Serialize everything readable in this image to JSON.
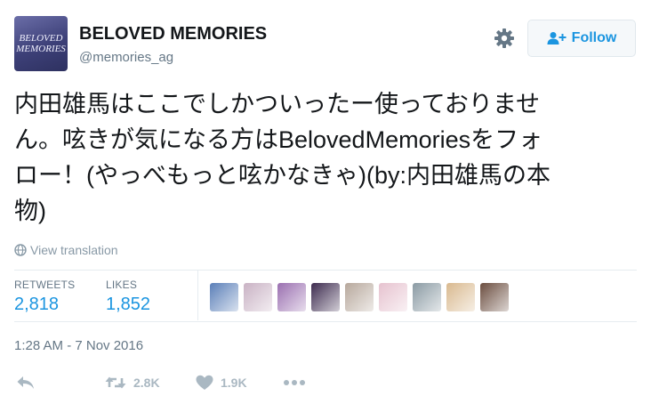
{
  "user": {
    "display_name": "BELOVED MEMORIES",
    "handle": "@memories_ag",
    "avatar_text": "BELOVED MEMORIES"
  },
  "follow_label": "Follow",
  "tweet": {
    "line1": "内田雄馬はここでしかついったー使っておりませ",
    "line2": "ん。呟きが気になる方はBelovedMemoriesをフォ",
    "line3": "ロー！(やっべもっと呟かなきゃ)(by:内田雄馬の本",
    "line4": "物)"
  },
  "view_translation": "View translation",
  "stats": {
    "retweets_label": "RETWEETS",
    "retweets_value": "2,818",
    "likes_label": "LIKES",
    "likes_value": "1,852"
  },
  "likers": [
    {
      "color": "#5a7fb8"
    },
    {
      "color": "#c9b2c4"
    },
    {
      "color": "#9a6fb0"
    },
    {
      "color": "#3c2a4e"
    },
    {
      "color": "#b7a89c"
    },
    {
      "color": "#e6c2cf"
    },
    {
      "color": "#8a9aa3"
    },
    {
      "color": "#d9b98f"
    },
    {
      "color": "#6b4d3f"
    }
  ],
  "timestamp": "1:28 AM - 7 Nov 2016",
  "actions": {
    "retweet_count": "2.8K",
    "like_count": "1.9K"
  },
  "colors": {
    "accent": "#1b95e0",
    "muted": "#657786",
    "icon": "#aab8c2"
  }
}
